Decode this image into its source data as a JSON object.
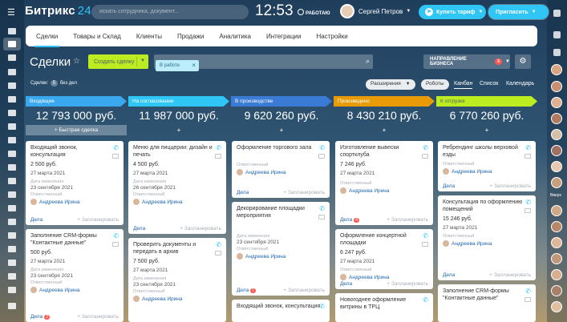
{
  "app": {
    "logo_text": "Битрикс",
    "logo_num": "24",
    "search_placeholder": "искать сотрудника, документ...",
    "clock": "12:53",
    "working": "РАБОТАЮ",
    "user_name": "Сергей Петров",
    "buy_label": "Купить тариф",
    "invite_label": "Пригласить"
  },
  "nav": {
    "tabs": [
      "Сделки",
      "Товары и Склад",
      "Клиенты",
      "Продажи",
      "Аналитика",
      "Интеграции",
      "Настройки"
    ]
  },
  "toolbar": {
    "title": "Сделки",
    "create_label": "Создать сделку",
    "filter_chip": "В работе",
    "direction_label": "НАПРАВЛЕНИЕ БИЗНЕСА",
    "direction_count": "5"
  },
  "info": {
    "deals_label": "Сделки:",
    "deals_count": "5",
    "no_deals": "без дел",
    "extensions": "Расширения",
    "robots": "Роботы",
    "views": [
      "Канбан",
      "Список",
      "Календарь"
    ]
  },
  "rightbar": {
    "label": "Вверх"
  },
  "colors": {
    "accent": "#2fc6f6",
    "create": "#bbed21",
    "stage1": "#39a8ef",
    "stage2": "#2fc6f6",
    "stage3": "#3a7bd5",
    "stage4": "#e89b06",
    "stage5": "#bbed21"
  },
  "columns": [
    {
      "name": "Входящие",
      "sum": "12 793 000 руб.",
      "add": "+ Быстрая сделка",
      "cards": [
        {
          "title": "Входящий звонок, консультация",
          "price": "2 500 руб.",
          "date": "27 марта 2021",
          "lbl_mod": "Дата изменения",
          "mod": "23 сентября 2021",
          "lbl_resp": "Ответственный",
          "resp": "Андреева Ирина",
          "deals": "Дела",
          "plan": "+ Запланировать",
          "cnt": ""
        },
        {
          "title": "Заполнение CRM-формы \"Контактные данные\"",
          "price": "500 руб.",
          "date": "27 марта 2021",
          "lbl_mod": "Дата изменения",
          "mod": "23 сентября 2021",
          "lbl_resp": "Ответственный",
          "resp": "Андреева Ирина",
          "deals": "Дела",
          "plan": "+ Запланировать",
          "cnt": "2"
        }
      ]
    },
    {
      "name": "На согласовании",
      "sum": "11 987 000 руб.",
      "add": "+",
      "cards": [
        {
          "title": "Меню для пиццерии: дизайн и печать",
          "price": "4 500 руб.",
          "date": "27 марта 2021",
          "lbl_mod": "Дата изменения",
          "mod": "26 сентября 2021",
          "lbl_resp": "Ответственный",
          "resp": "Андреева Ирина",
          "deals": "Дела",
          "plan": "+ Запланировать",
          "cnt": ""
        },
        {
          "title": "Проверить документы и передать в архив",
          "price": "7 500 руб.",
          "date": "27 марта 2021",
          "lbl_mod": "Дата изменения",
          "mod": "23 сентября 2021",
          "lbl_resp": "Ответственный",
          "resp": "Андреева Ирина",
          "deals": "Дела",
          "plan": "+ Запланировать",
          "cnt": ""
        }
      ]
    },
    {
      "name": "В производстве",
      "sum": "9 620 260 руб.",
      "add": "+",
      "cards": [
        {
          "title": "Оформление торгового зала",
          "price": "",
          "date": "",
          "lbl_mod": "",
          "mod": "",
          "lbl_resp": "Ответственный",
          "resp": "Андреева Ирина",
          "deals": "Дела",
          "plan": "+ Запланировать",
          "cnt": ""
        },
        {
          "title": "Декорирование площадки мероприятия",
          "price": "",
          "date": "",
          "lbl_mod": "Дата изменения",
          "mod": "23 сентября 2021",
          "lbl_resp": "Ответственный",
          "resp": "Андреева Ирина",
          "deals": "Дела",
          "plan": "+ Запланировать",
          "cnt": "1"
        },
        {
          "title": "Входящий звонок, консультация",
          "price": "",
          "date": "",
          "lbl_mod": "",
          "mod": "",
          "lbl_resp": "",
          "resp": "",
          "deals": "",
          "plan": "",
          "cnt": ""
        }
      ]
    },
    {
      "name": "Произведено",
      "sum": "8 430 210 руб.",
      "add": "+",
      "cards": [
        {
          "title": "Изготовление вывески спортклуба",
          "price": "7 246 руб.",
          "date": "27 марта 2021",
          "lbl_mod": "",
          "mod": "",
          "lbl_resp": "Ответственный",
          "resp": "Андреева Ирина",
          "deals": "Дела",
          "plan": "+ Запланировать",
          "cnt": "4"
        },
        {
          "title": "Оформление концертной площадки",
          "price": "6 247 руб.",
          "date": "27 марта 2021",
          "lbl_mod": "",
          "mod": "",
          "lbl_resp": "Ответственный",
          "resp": "Андреева Ирина",
          "deals": "Дела",
          "plan": "+ Запланировать",
          "cnt": ""
        },
        {
          "title": "Новогоднее оформление витрины в ТРЦ",
          "price": "",
          "date": "",
          "lbl_mod": "",
          "mod": "",
          "lbl_resp": "",
          "resp": "",
          "deals": "",
          "plan": "",
          "cnt": ""
        }
      ]
    },
    {
      "name": "К отгрузке",
      "sum": "6 770 260 руб.",
      "add": "+",
      "cards": [
        {
          "title": "Ребрендинг школы верховой езды",
          "price": "",
          "date": "",
          "lbl_mod": "",
          "mod": "",
          "lbl_resp": "Ответственный",
          "resp": "Андреева Ирина",
          "deals": "Дела",
          "plan": "+ Запланировать",
          "cnt": ""
        },
        {
          "title": "Консультация по оформлению помещений",
          "price": "15 246 руб.",
          "date": "27 марта 2021",
          "lbl_mod": "",
          "mod": "",
          "lbl_resp": "Ответственный",
          "resp": "Андреева Ирина",
          "deals": "Дела",
          "plan": "+ Запланировать",
          "cnt": ""
        },
        {
          "title": "Заполнение CRM-формы \"Контактные данные\"",
          "price": "",
          "date": "",
          "lbl_mod": "",
          "mod": "",
          "lbl_resp": "",
          "resp": "",
          "deals": "",
          "plan": "",
          "cnt": ""
        }
      ]
    }
  ]
}
